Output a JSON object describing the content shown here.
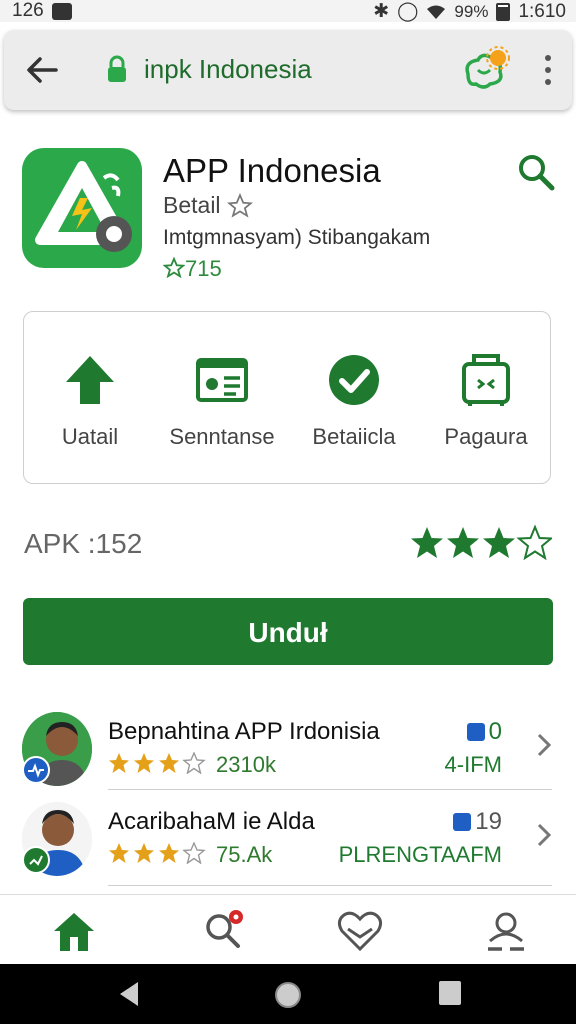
{
  "status_bar": {
    "time_left": "126",
    "battery_pct": "99%",
    "time_right": "1:610"
  },
  "address_bar": {
    "url_text": "inpk Indonesia"
  },
  "app": {
    "title": "APP Indonesia",
    "subtitle": "Betail",
    "description": "Imtgmnasyam) Stibangakam",
    "rating": "715"
  },
  "categories": [
    {
      "label": "Uatail",
      "icon": "upload-arrow-icon"
    },
    {
      "label": "Senntanse",
      "icon": "id-card-icon"
    },
    {
      "label": "Betaiicla",
      "icon": "check-circle-icon"
    },
    {
      "label": "Pagaura",
      "icon": "package-box-icon"
    }
  ],
  "apk": {
    "label": "APK :152",
    "stars_filled": 3,
    "stars_total": 4
  },
  "download_button": {
    "label": "Unduł"
  },
  "list": [
    {
      "name": "Bepnahtina APP Irdonisia",
      "stars_filled": 3,
      "stars_total": 4,
      "count": "2310k",
      "number": "0",
      "tag": "4-IFM"
    },
    {
      "name": "AcaribahaM ie Alda",
      "stars_filled": 3,
      "stars_total": 4,
      "count": "75.Ak",
      "number": "19",
      "tag": "PLRENGTAAFM"
    }
  ],
  "colors": {
    "primary_green": "#1f7a30",
    "accent_green": "#2aa84a",
    "star_orange": "#e5a01a"
  }
}
